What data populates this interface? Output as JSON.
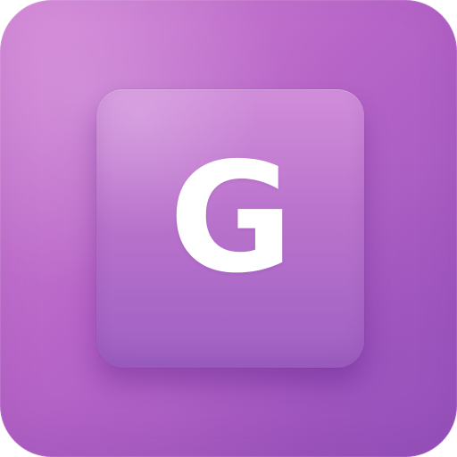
{
  "app_icon": {
    "letter": "G"
  }
}
